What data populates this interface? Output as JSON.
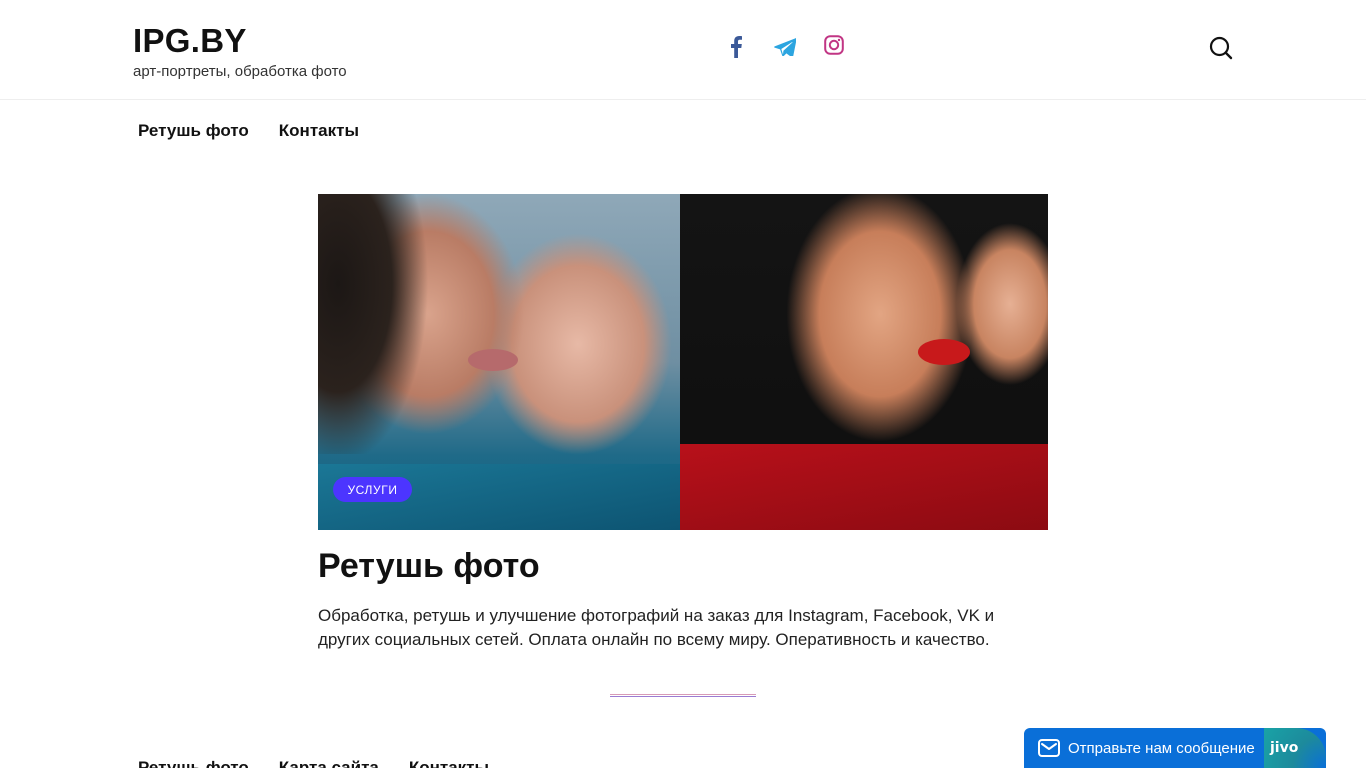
{
  "site": {
    "logo": "IPG.BY",
    "tagline": "арт-портреты, обработка фото"
  },
  "social": [
    {
      "icon": "facebook-icon",
      "color": "#3b5998"
    },
    {
      "icon": "telegram-icon",
      "color": "#2ca5e0"
    },
    {
      "icon": "instagram-icon",
      "color": "#c13584"
    }
  ],
  "nav": {
    "items": [
      {
        "label": "Ретушь фото"
      },
      {
        "label": "Контакты"
      }
    ]
  },
  "post": {
    "category": "УСЛУГИ",
    "title": "Ретушь фото",
    "excerpt": "Обработка, ретушь и улучшение фотографий на заказ для Instagram, Facebook, VK и других социальных сетей. Оплата онлайн по всему миру. Оперативность и качество."
  },
  "footer_nav": {
    "items": [
      {
        "label": "Ретушь фото"
      },
      {
        "label": "Карта сайта"
      },
      {
        "label": "Контакты"
      }
    ]
  },
  "chat": {
    "label": "Отправьте нам сообщение",
    "brand": "jivo",
    "color": "#0a6fd8"
  },
  "colors": {
    "badge": "#4c35ff",
    "accent_divider": "#d79bb7"
  }
}
